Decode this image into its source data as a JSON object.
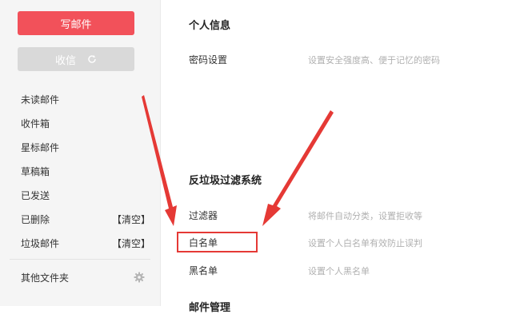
{
  "sidebar": {
    "compose_label": "写邮件",
    "receive_label": "收信",
    "items": [
      {
        "label": "未读邮件"
      },
      {
        "label": "收件箱"
      },
      {
        "label": "星标邮件"
      },
      {
        "label": "草稿箱"
      },
      {
        "label": "已发送"
      },
      {
        "label": "已删除",
        "action": "【清空】"
      },
      {
        "label": "垃圾邮件",
        "action": "【清空】"
      }
    ],
    "other_folders_label": "其他文件夹",
    "icons": {
      "refresh": "refresh-icon",
      "settings": "gear-icon"
    }
  },
  "main": {
    "personal": {
      "title": "个人信息",
      "rows": [
        {
          "label": "密码设置",
          "desc": "设置安全强度高、便于记忆的密码"
        }
      ]
    },
    "antispam": {
      "title": "反垃圾过滤系统",
      "rows": [
        {
          "label": "过滤器",
          "desc": "将邮件自动分类，设置拒收等"
        },
        {
          "label": "白名单",
          "desc": "设置个人白名单有效防止误判"
        },
        {
          "label": "黑名单",
          "desc": "设置个人黑名单"
        }
      ]
    },
    "mail_manage": {
      "title": "邮件管理"
    }
  },
  "colors": {
    "accent": "#f2515a",
    "annotation": "#e53935"
  }
}
